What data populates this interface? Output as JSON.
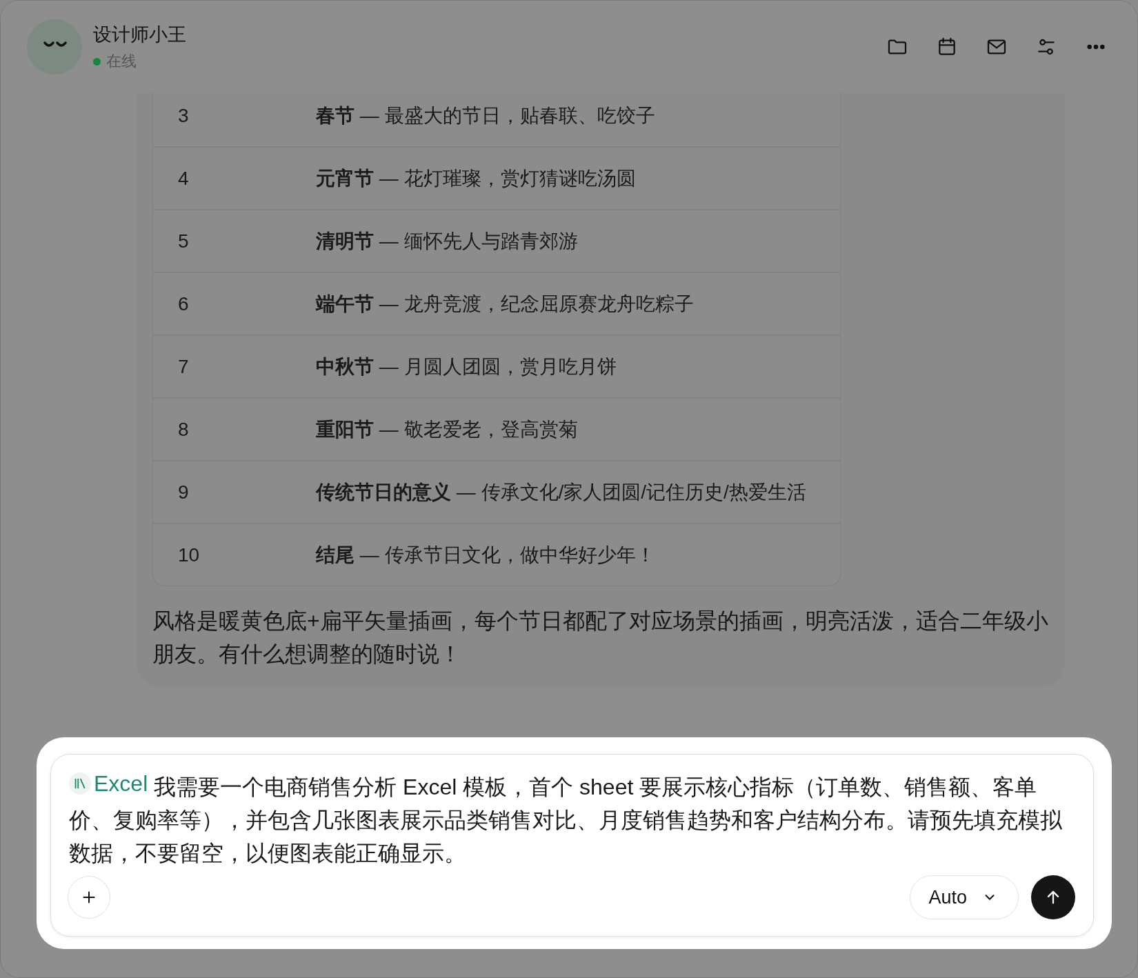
{
  "header": {
    "name": "设计师小王",
    "status": {
      "label": "在线",
      "online": true
    }
  },
  "toolbar": [
    {
      "kind": "folder"
    },
    {
      "kind": "calendar"
    },
    {
      "kind": "mail"
    },
    {
      "kind": "sliders"
    },
    {
      "kind": "more"
    }
  ],
  "table": {
    "rows": [
      {
        "number": "3",
        "content": "**春节** — 最盛大的节日，贴春联、吃饺子"
      },
      {
        "number": "4",
        "content": "**元宵节** — 花灯璀璨，赏灯猜谜吃汤圆"
      },
      {
        "number": "5",
        "content": "**清明节** — 缅怀先人与踏青郊游"
      },
      {
        "number": "6",
        "content": "**端午节** — 龙舟竞渡，纪念屈原赛龙舟吃粽子"
      },
      {
        "number": "7",
        "content": "**中秋节** — 月圆人团圆，赏月吃月饼"
      },
      {
        "number": "8",
        "content": "**重阳节** — 敬老爱老，登高赏菊"
      },
      {
        "number": "9",
        "content": "**传统节日的意义** — 传承文化/家人团圆/记住历史/热爱生活"
      },
      {
        "number": "10",
        "content": "**结尾** — 传承节日文化，做中华好少年！"
      }
    ]
  },
  "message": "风格是暖黄色底+扁平矢量插画，每个节日都配了对应场景的插画，明亮活泼，适合二年级小朋友。有什么想调整的随时说！",
  "composer": {
    "tag": "Excel",
    "value": "我需要一个电商销售分析 Excel 模板，首个 sheet 要展示核心指标（订单数、销售额、客单价、复购率等），并包含几张图表展示品类销售对比、月度销售趋势和客户结构分布。请预先填充模拟数据，不要留空，以便图表能正确显示。",
    "model": "Auto"
  }
}
